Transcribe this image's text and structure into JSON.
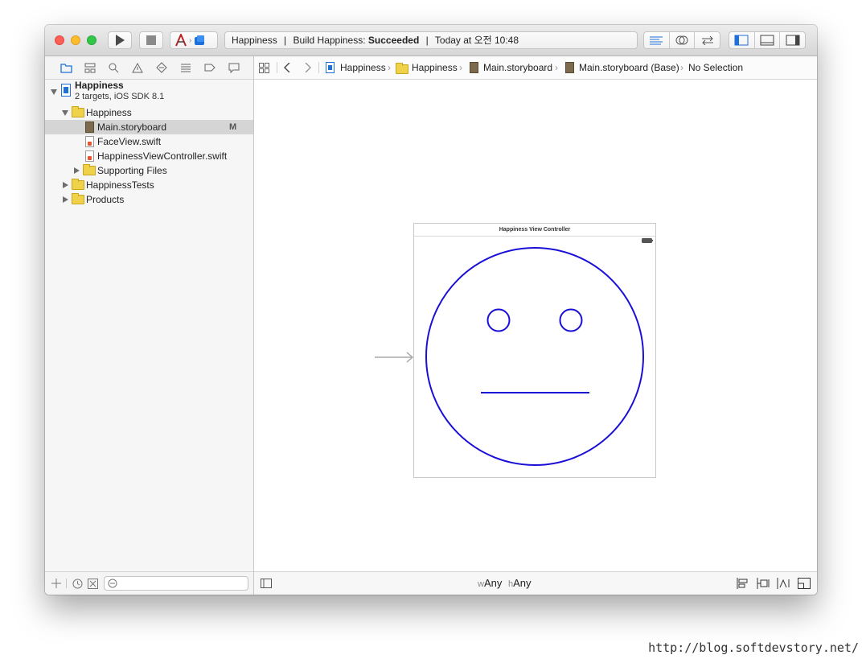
{
  "toolbar": {
    "scheme_name": "Happiness",
    "activity_project": "Happiness",
    "activity_build": "Build Happiness:",
    "activity_status": "Succeeded",
    "activity_time": "Today at 오전 10:48",
    "separator": "|"
  },
  "navigator": {
    "project": {
      "name": "Happiness",
      "subtitle": "2 targets, iOS SDK 8.1"
    },
    "items": [
      {
        "label": "Happiness"
      },
      {
        "label": "Main.storyboard",
        "badge": "M"
      },
      {
        "label": "FaceView.swift"
      },
      {
        "label": "HappinessViewController.swift"
      },
      {
        "label": "Supporting Files"
      },
      {
        "label": "HappinessTests"
      },
      {
        "label": "Products"
      }
    ]
  },
  "jumpbar": {
    "crumbs": [
      "Happiness",
      "Happiness",
      "Main.storyboard",
      "Main.storyboard (Base)",
      "No Selection"
    ]
  },
  "scene": {
    "title": "Happiness View Controller"
  },
  "footer": {
    "w_prefix": "w",
    "w_value": "Any",
    "h_prefix": "h",
    "h_value": "Any"
  },
  "colors": {
    "face_stroke": "#1a0fd6",
    "selection": "#d5d5d5",
    "accent": "#1e6fd9"
  },
  "watermark": "http://blog.softdevstory.net/"
}
